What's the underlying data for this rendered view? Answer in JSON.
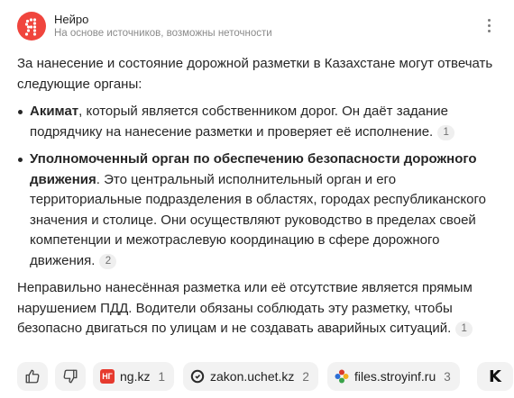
{
  "header": {
    "brand": "Нейро",
    "subtitle": "На основе источников, возможны неточности",
    "logo_icon": "neuro-logo-icon",
    "menu_icon": "more-vertical-icon"
  },
  "answer": {
    "intro": "За нанесение и состояние дорожной разметки в Казахстане могут отвечать следующие органы:",
    "items": [
      {
        "bold": "Акимат",
        "text": ", который является собственником дорог. Он даёт задание подрядчику на нанесение разметки и проверяет её исполнение.",
        "ref": "1"
      },
      {
        "bold": "Уполномоченный орган по обеспечению безопасности дорожного движения",
        "text": ". Это центральный исполнительный орган и его территориальные подразделения в областях, городах республиканского значения и столице. Они осуществляют руководство в пределах своей компетенции и межотраслевую координацию в сфере дорожного движения.",
        "ref": "2"
      }
    ],
    "outro": "Неправильно нанесённая разметка или её отсутствие является прямым нарушением ПДД. Водители обязаны соблюдать эту разметку, чтобы безопасно двигаться по улицам и не создавать аварийных ситуаций.",
    "outro_ref": "1"
  },
  "footer": {
    "like_icon": "thumbs-up-icon",
    "dislike_icon": "thumbs-down-icon",
    "sources": [
      {
        "label": "ng.kz",
        "count": "1",
        "icon": "ng-kz-favicon"
      },
      {
        "label": "zakon.uchet.kz",
        "count": "2",
        "icon": "zakon-uchet-favicon"
      },
      {
        "label": "files.stroyinf.ru",
        "count": "3",
        "icon": "stroyinf-favicon"
      },
      {
        "label": "",
        "count": "",
        "icon": "k-source-favicon",
        "glyph": "K"
      }
    ]
  },
  "colors": {
    "logo_red": "#f0453d",
    "chip_bg": "#f2f2f2",
    "ref_bg": "#efefef",
    "muted_text": "#8b8b8b"
  }
}
